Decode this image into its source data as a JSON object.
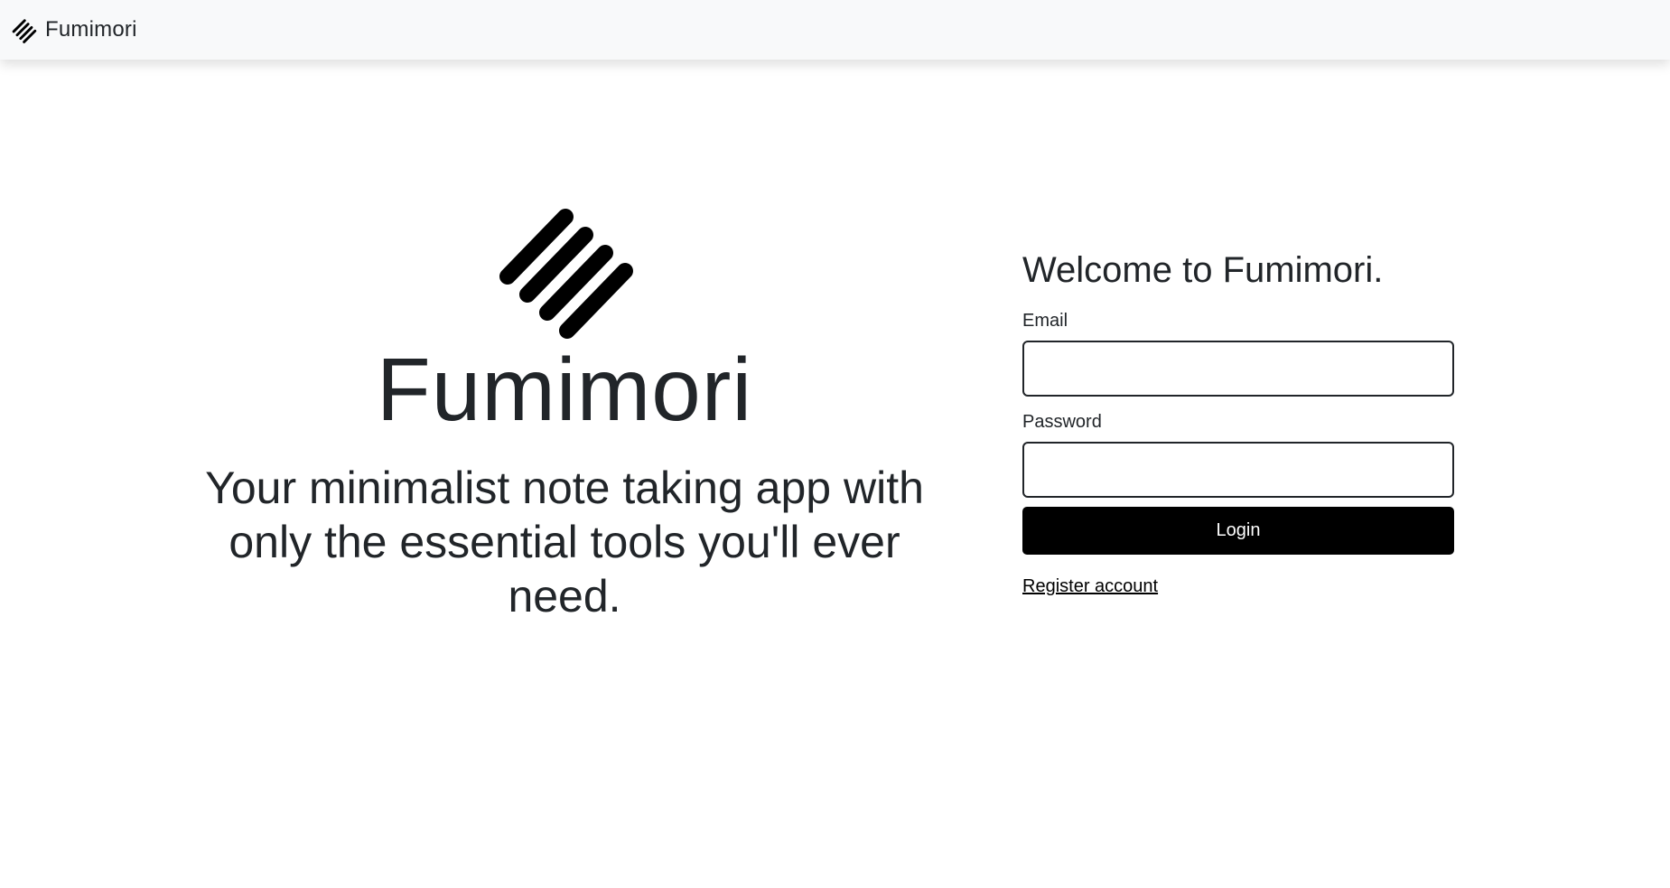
{
  "navbar": {
    "brand_name": "Fumimori",
    "logo_icon": "fumimori-stripes-logo"
  },
  "hero": {
    "logo_icon": "fumimori-stripes-logo",
    "title": "Fumimori",
    "tagline": "Your minimalist note taking app with only the essential tools you'll ever need."
  },
  "login": {
    "heading": "Welcome to Fumimori.",
    "email_label": "Email",
    "email_value": "",
    "password_label": "Password",
    "password_value": "",
    "login_button": "Login",
    "register_link": "Register account"
  },
  "colors": {
    "navbar_bg": "#f8f9fa",
    "text": "#212529",
    "button_bg": "#000000",
    "button_text": "#ffffff"
  }
}
